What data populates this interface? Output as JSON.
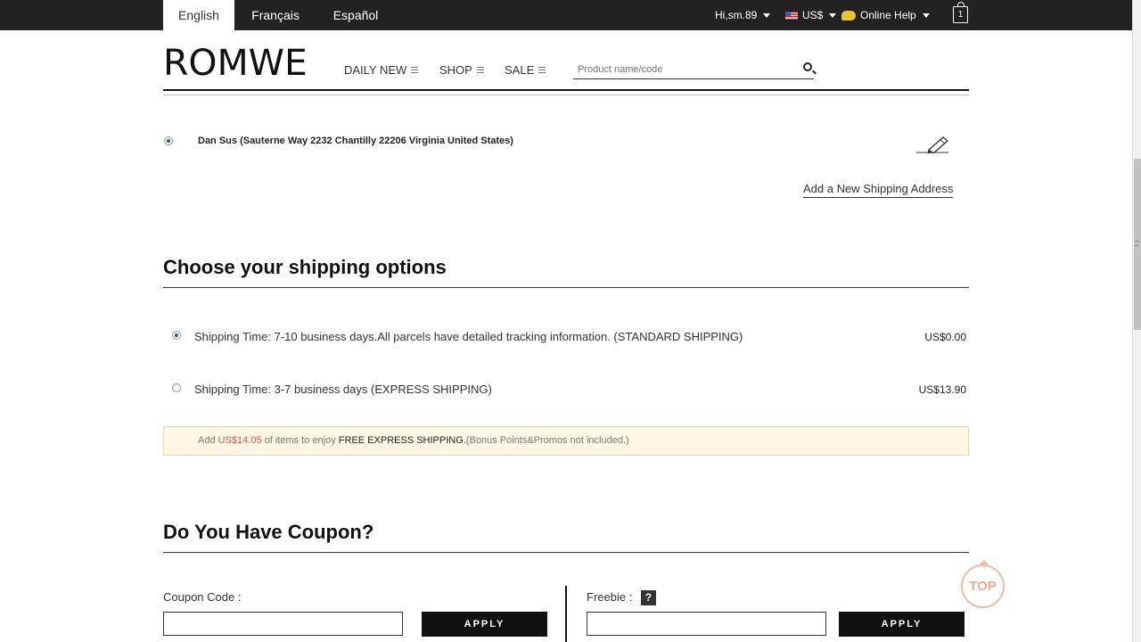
{
  "topbar": {
    "languages": [
      "English",
      "Français",
      "Español"
    ],
    "active_language": "English",
    "user_greeting": "Hi,sm.89",
    "currency": "US$",
    "help": "Online Help",
    "cart_count": "1"
  },
  "header": {
    "logo": "ROMWE",
    "nav": [
      "DAILY NEW",
      "SHOP",
      "SALE"
    ],
    "search_placeholder": "Product name/code"
  },
  "address": {
    "selected_address": "Dan Sus (Sauterne Way 2232 Chantilly 22206 Virginia United States)",
    "add_new": "Add a New Shipping Address"
  },
  "shipping": {
    "title": "Choose your shipping options",
    "options": [
      {
        "label": "Shipping Time: 7-10 business days.All parcels have detailed tracking information. (STANDARD SHIPPING)",
        "price": "US$0.00",
        "selected": true
      },
      {
        "label": "Shipping Time: 3-7 business days (EXPRESS SHIPPING)",
        "price": "US$13.90",
        "selected": false
      }
    ],
    "notice": {
      "prefix": "Add",
      "amount": "US$14.05",
      "middle": "of items to enjoy",
      "highlight": "FREE EXPRESS SHIPPING.",
      "suffix": "(Bonus Points&Promos not included.)"
    }
  },
  "coupon": {
    "title": "Do You Have Coupon?",
    "coupon_label": "Coupon Code :",
    "freebie_label": "Freebie :",
    "help_icon": "?",
    "apply_label": "APPLY"
  },
  "top_button": "TOP"
}
